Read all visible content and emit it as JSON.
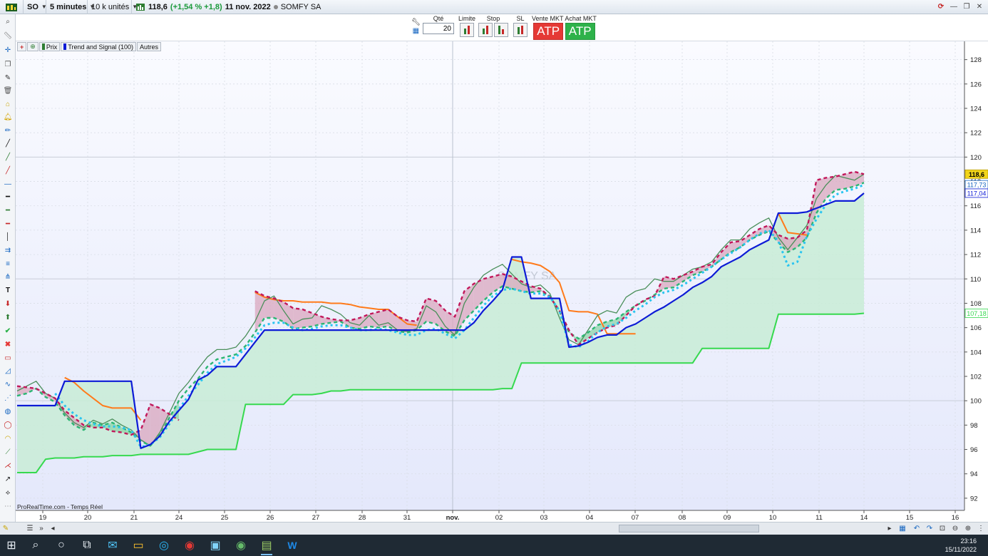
{
  "window": {
    "symbol": "SO",
    "timeframe": "5 minutes",
    "units": "10 k unités",
    "price": "118,6",
    "change": "(+1,54 % +1,8)",
    "date": "11 nov. 2022",
    "instrument": "SOMFY SA"
  },
  "order_bar": {
    "qty_label": "Qté",
    "qty_value": "20",
    "limit_label": "Limite",
    "stop_label": "Stop",
    "sl_label": "SL",
    "sell_label": "Vente MKT",
    "buy_label": "Achat MKT",
    "sell_button": "ATP",
    "buy_button": "ATP",
    "sell_color": "#e53935",
    "buy_color": "#2eb24a"
  },
  "legend": {
    "price_label": "Prix",
    "indicator_label": "Trend and Signal (100)",
    "other_label": "Autres"
  },
  "chart_data": {
    "type": "line",
    "watermark": "SOMFY SA",
    "source_text": "ProRealTime.com - Temps Réel",
    "ylim": [
      91,
      129.5
    ],
    "y_ticks": [
      92,
      94,
      96,
      98,
      100,
      102,
      104,
      106,
      108,
      110,
      112,
      114,
      116,
      118,
      120,
      122,
      124,
      126,
      128
    ],
    "x_categories": [
      "19",
      "20",
      "21",
      "24",
      "25",
      "26",
      "27",
      "28",
      "31",
      "nov.",
      "02",
      "03",
      "04",
      "07",
      "08",
      "09",
      "10",
      "11",
      "14",
      "15",
      "16"
    ],
    "price_tags": [
      {
        "label": "118,6",
        "value": 118.6,
        "bg": "#f2d51a",
        "fg": "#000000"
      },
      {
        "label": "117,73",
        "value": 117.73,
        "bg": "#ffffff",
        "fg": "#1565c0"
      },
      {
        "label": "117,04",
        "value": 117.04,
        "bg": "#ffffff",
        "fg": "#0d1bd6"
      },
      {
        "label": "107,18",
        "value": 107.18,
        "bg": "#ffffff",
        "fg": "#36d94f"
      }
    ],
    "series": [
      {
        "color": "#4a8f5a",
        "values": [
          100.8,
          101.2,
          101.6,
          100.6,
          100.2,
          99.0,
          98.2,
          97.8,
          98.4,
          98.1,
          98.5,
          98.0,
          97.6,
          96.8,
          96.3,
          97.4,
          99.0,
          100.6,
          101.5,
          102.6,
          103.6,
          104.2,
          104.2,
          104.4,
          105.3,
          106.5,
          108.2,
          108.6,
          107.4,
          106.3,
          106.7,
          106.8,
          107.8,
          107.5,
          107.1,
          106.4,
          106.2,
          107.0,
          106.2,
          106.4,
          105.8,
          105.7,
          105.9,
          107.8,
          107.3,
          106.1,
          105.4,
          108.0,
          109.3,
          110.3,
          110.8,
          111.2,
          110.4,
          109.6,
          109.3,
          109.5,
          108.8,
          106.8,
          105.0,
          104.6,
          105.8,
          107.0,
          107.4,
          107.2,
          108.5,
          109.0,
          109.2,
          110.0,
          109.8,
          109.8,
          110.3,
          110.8,
          111.0,
          111.4,
          112.4,
          113.2,
          113.2,
          114.1,
          114.6,
          115.0,
          113.4,
          112.4,
          113.4,
          114.4,
          116.6,
          117.7,
          118.5,
          118.3,
          118.1,
          118.6
        ]
      },
      {
        "color": "#0d1bd6",
        "values": [
          99.6,
          99.6,
          99.6,
          99.6,
          99.6,
          101.6,
          101.6,
          101.6,
          101.6,
          101.6,
          101.6,
          101.6,
          101.6,
          96.1,
          96.4,
          97.1,
          98.3,
          99.2,
          100.1,
          101.7,
          102.1,
          102.8,
          102.8,
          102.8,
          103.8,
          104.8,
          105.8,
          105.8,
          105.8,
          105.8,
          105.8,
          105.8,
          105.8,
          105.8,
          105.8,
          105.8,
          105.8,
          105.8,
          105.8,
          105.8,
          105.8,
          105.8,
          105.8,
          105.8,
          105.8,
          105.8,
          105.8,
          105.8,
          106.4,
          107.4,
          108.2,
          109.1,
          111.8,
          111.8,
          108.4,
          108.4,
          108.4,
          108.4,
          104.4,
          104.5,
          104.8,
          105.2,
          105.4,
          105.4,
          106.0,
          106.3,
          106.8,
          107.3,
          107.7,
          108.2,
          108.7,
          109.3,
          109.7,
          110.2,
          111.0,
          111.4,
          111.8,
          112.4,
          112.8,
          113.2,
          115.4,
          115.4,
          115.4,
          115.5,
          115.8,
          116.1,
          116.4,
          116.4,
          116.4,
          117.04
        ]
      },
      {
        "color": "#36d94f",
        "values": [
          94.1,
          94.1,
          94.1,
          95.2,
          95.3,
          95.3,
          95.3,
          95.4,
          95.4,
          95.4,
          95.5,
          95.5,
          95.5,
          95.6,
          95.6,
          95.6,
          95.6,
          95.6,
          95.6,
          95.8,
          96.0,
          96.0,
          96.0,
          96.0,
          99.7,
          99.7,
          99.7,
          99.7,
          99.7,
          100.5,
          100.5,
          100.5,
          100.6,
          100.8,
          100.8,
          100.9,
          100.9,
          100.9,
          100.9,
          100.9,
          100.9,
          100.9,
          100.9,
          100.9,
          100.9,
          100.9,
          100.9,
          100.9,
          100.9,
          100.9,
          100.9,
          101.0,
          101.0,
          103.1,
          103.1,
          103.1,
          103.1,
          103.1,
          103.1,
          103.1,
          103.1,
          103.1,
          103.1,
          103.1,
          103.1,
          103.1,
          103.1,
          103.1,
          103.1,
          103.1,
          103.1,
          103.1,
          104.3,
          104.3,
          104.3,
          104.3,
          104.3,
          104.3,
          104.3,
          104.3,
          107.1,
          107.1,
          107.1,
          107.1,
          107.1,
          107.1,
          107.1,
          107.1,
          107.1,
          107.18
        ]
      },
      {
        "color": "#ff7a1a",
        "values": [
          null,
          null,
          null,
          null,
          null,
          101.9,
          101.5,
          100.8,
          100.2,
          99.6,
          99.4,
          99.4,
          99.4,
          98.4,
          null,
          null,
          null,
          null,
          null,
          null,
          null,
          null,
          null,
          null,
          null,
          108.9,
          108.5,
          108.3,
          108.2,
          108.2,
          108.1,
          108.1,
          108.1,
          108.0,
          108.0,
          107.9,
          107.7,
          107.6,
          107.5,
          107.5,
          106.9,
          106.3,
          106.2,
          null,
          null,
          null,
          null,
          null,
          null,
          null,
          null,
          null,
          111.6,
          111.4,
          111.3,
          111.1,
          110.6,
          109.7,
          107.4,
          107.3,
          107.3,
          107.1,
          105.5,
          105.5,
          105.5,
          105.5,
          null,
          null,
          null,
          null,
          null,
          null,
          null,
          null,
          null,
          null,
          null,
          null,
          null,
          null,
          115.4,
          113.8,
          113.7,
          113.6,
          null,
          null,
          null,
          null,
          null,
          null
        ]
      },
      {
        "color": "#c2185b",
        "values": [
          101.2,
          101.1,
          101.0,
          100.6,
          100.2,
          99.2,
          98.6,
          98.0,
          97.8,
          97.8,
          97.5,
          97.4,
          97.2,
          97.6,
          99.7,
          99.4,
          98.9,
          98.4,
          null,
          null,
          null,
          null,
          null,
          null,
          null,
          109.0,
          108.6,
          108.4,
          108.1,
          107.6,
          107.5,
          107.2,
          106.9,
          106.7,
          106.6,
          106.6,
          106.8,
          107.1,
          107.3,
          107.5,
          106.9,
          106.6,
          106.5,
          108.4,
          108.2,
          107.4,
          106.9,
          109.0,
          109.6,
          110.0,
          110.2,
          110.4,
          110.2,
          109.8,
          109.4,
          109.2,
          108.5,
          107.4,
          105.8,
          104.6,
          105.1,
          105.6,
          106.0,
          106.2,
          107.0,
          107.8,
          108.3,
          108.6,
          110.2,
          110.0,
          110.3,
          110.6,
          111.0,
          111.2,
          112.2,
          113.0,
          113.1,
          113.6,
          114.1,
          114.4,
          113.6,
          113.3,
          113.4,
          114.0,
          118.1,
          118.3,
          118.4,
          118.6,
          118.8,
          118.6
        ]
      },
      {
        "color": "#2bb673",
        "values": [
          100.4,
          100.6,
          101.0,
          100.3,
          99.9,
          98.8,
          98.0,
          97.6,
          98.2,
          98.0,
          98.2,
          97.8,
          97.4,
          96.7,
          96.3,
          97.2,
          98.6,
          100.0,
          101.0,
          101.8,
          102.8,
          103.4,
          103.6,
          103.8,
          104.5,
          105.6,
          106.8,
          106.8,
          106.5,
          105.9,
          106.0,
          106.1,
          106.3,
          106.4,
          106.5,
          106.0,
          105.9,
          106.1,
          106.0,
          106.1,
          105.7,
          105.6,
          105.8,
          106.5,
          106.3,
          105.7,
          105.3,
          106.6,
          107.4,
          108.2,
          108.9,
          109.4,
          109.2,
          109.0,
          108.9,
          109.0,
          108.6,
          107.3,
          105.6,
          105.1,
          105.6,
          106.2,
          106.5,
          106.7,
          107.3,
          107.8,
          108.2,
          108.7,
          109.2,
          109.3,
          109.8,
          110.3,
          110.6,
          111.0,
          111.6,
          112.2,
          112.6,
          113.2,
          113.6,
          113.9,
          113.0,
          112.2,
          112.6,
          113.4,
          115.4,
          116.6,
          117.3,
          117.4,
          117.6,
          117.9
        ]
      },
      {
        "color": "#29c4f0",
        "values": [
          null,
          null,
          null,
          null,
          100.6,
          99.6,
          98.9,
          98.4,
          98.1,
          97.9,
          97.9,
          97.8,
          97.6,
          96.2,
          96.4,
          97.0,
          98.1,
          99.3,
          100.4,
          101.3,
          102.3,
          103.0,
          103.3,
          103.6,
          104.3,
          105.2,
          106.2,
          106.4,
          106.4,
          106.0,
          105.8,
          105.9,
          106.1,
          106.2,
          106.2,
          106.0,
          105.8,
          105.8,
          105.9,
          105.8,
          105.6,
          105.4,
          105.4,
          105.8,
          105.9,
          105.5,
          105.1,
          105.8,
          106.8,
          107.8,
          108.6,
          109.1,
          109.2,
          109.0,
          108.8,
          108.8,
          108.5,
          107.4,
          104.6,
          104.4,
          104.9,
          105.6,
          106.1,
          106.3,
          106.8,
          107.4,
          107.9,
          108.5,
          108.9,
          109.1,
          109.5,
          110.0,
          110.5,
          111.0,
          111.6,
          112.1,
          112.6,
          113.2,
          113.7,
          114.0,
          113.1,
          111.1,
          111.4,
          113.5,
          114.9,
          116.1,
          116.9,
          117.2,
          117.4,
          117.73
        ]
      }
    ]
  },
  "status": {
    "clock_time": "23:16",
    "clock_date": "15/11/2022"
  }
}
